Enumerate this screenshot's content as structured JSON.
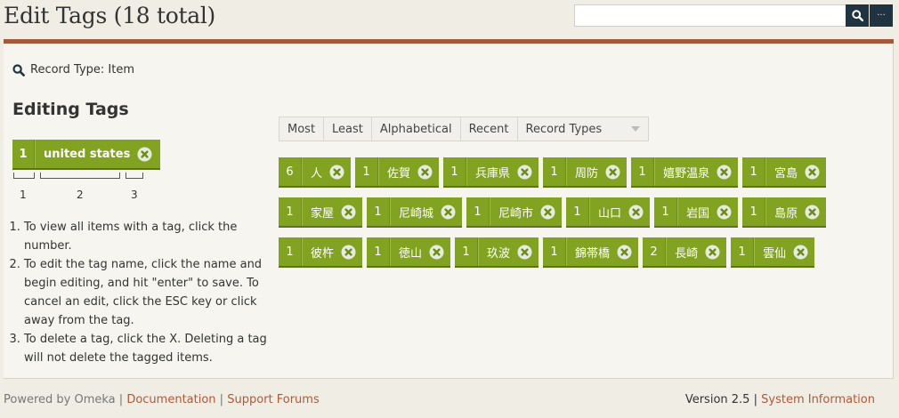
{
  "header": {
    "title": "Edit Tags (18 total)",
    "search": {
      "placeholder": "",
      "value": ""
    },
    "search_button_icon": "search-icon",
    "options_label": "···"
  },
  "filter": {
    "record_type_text": "Record Type: Item"
  },
  "editing": {
    "title": "Editing Tags",
    "example_tag": {
      "count": "1",
      "name": "united states"
    },
    "legend_numbers": [
      "1",
      "2",
      "3"
    ],
    "instructions": [
      "To view all items with a tag, click the number.",
      "To edit the tag name, click the name and begin editing, and hit \"enter\" to save. To cancel an edit, click the ESC key or click away from the tag.",
      "To delete a tag, click the X. Deleting a tag will not delete the tagged items."
    ]
  },
  "sort": {
    "tabs": [
      "Most",
      "Least",
      "Alphabetical",
      "Recent"
    ],
    "select_value": "Record Types"
  },
  "tags": [
    [
      {
        "count": "6",
        "name": "人"
      },
      {
        "count": "1",
        "name": "佐賀"
      },
      {
        "count": "1",
        "name": "兵庫県"
      },
      {
        "count": "1",
        "name": "周防"
      },
      {
        "count": "1",
        "name": "嬉野温泉"
      },
      {
        "count": "1",
        "name": "宮島"
      }
    ],
    [
      {
        "count": "1",
        "name": "家屋"
      },
      {
        "count": "1",
        "name": "尼崎城"
      },
      {
        "count": "1",
        "name": "尼崎市"
      },
      {
        "count": "1",
        "name": "山口"
      },
      {
        "count": "1",
        "name": "岩国"
      },
      {
        "count": "1",
        "name": "島原"
      }
    ],
    [
      {
        "count": "1",
        "name": "彼杵"
      },
      {
        "count": "1",
        "name": "徳山"
      },
      {
        "count": "1",
        "name": "玖波"
      },
      {
        "count": "1",
        "name": "錦帯橋"
      },
      {
        "count": "2",
        "name": "長崎"
      },
      {
        "count": "1",
        "name": "雲仙"
      }
    ]
  ],
  "footer": {
    "powered_by": "Powered by Omeka",
    "sep": "|",
    "documentation": "Documentation",
    "support_forums": "Support Forums",
    "version": "Version 2.5",
    "system_information": "System Information"
  },
  "colors": {
    "tag_green": "#82a321",
    "header_rule": "#a45a38",
    "search_button": "#1f3440",
    "link": "#b0593a"
  }
}
